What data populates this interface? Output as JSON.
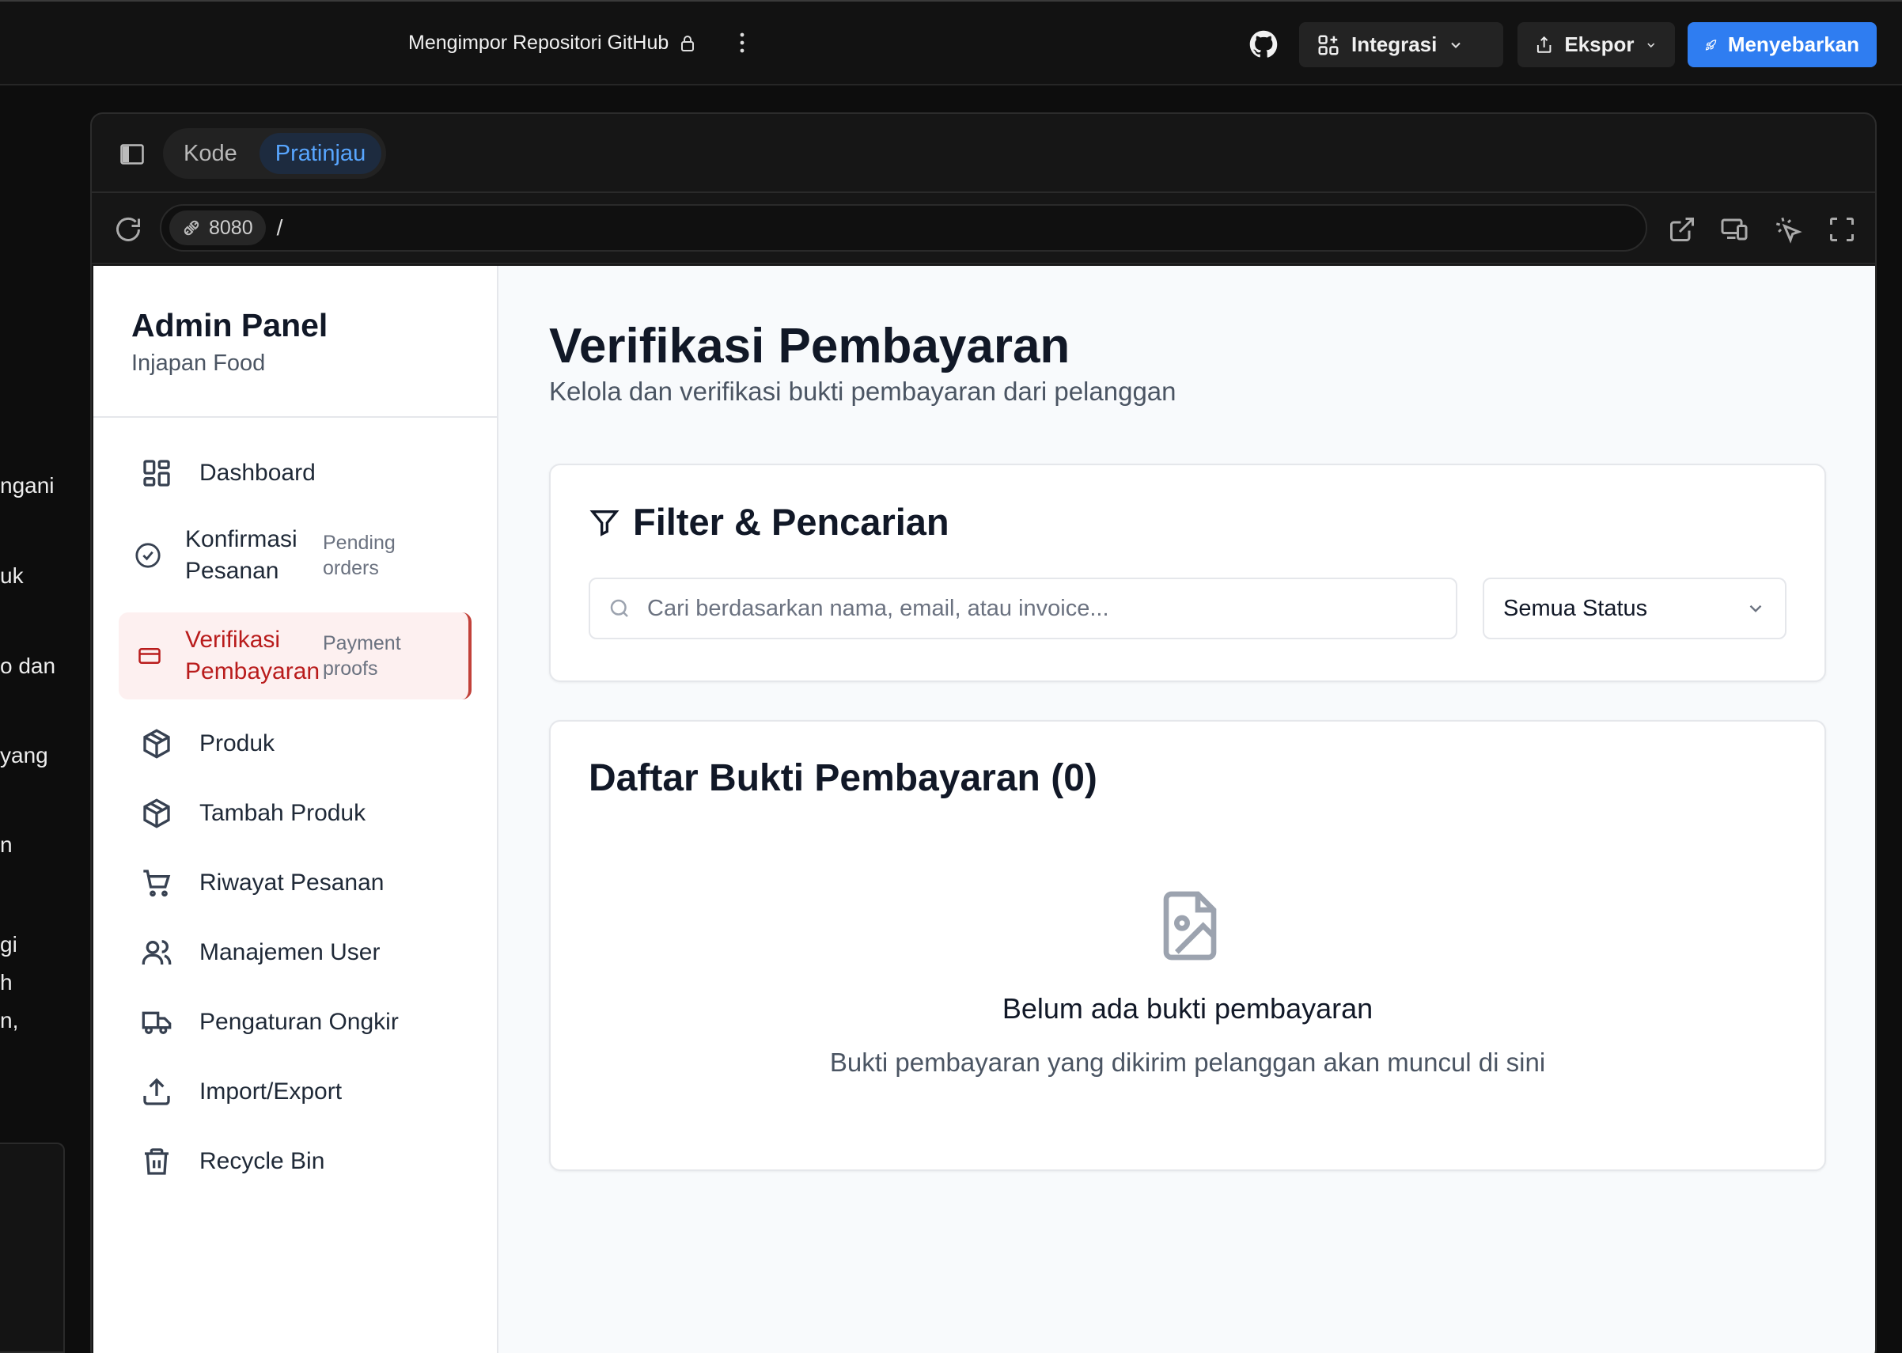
{
  "topbar": {
    "project_title": "Mengimpor Repositori GitHub",
    "integrations_label": "Integrasi",
    "export_label": "Ekspor",
    "deploy_label": "Menyebarkan"
  },
  "background_text": [
    "ngani",
    "uk",
    "o dan",
    "yang",
    "n",
    "gi",
    "h",
    "n,"
  ],
  "preview": {
    "tabs": [
      "Kode",
      "Pratinjau"
    ],
    "active_tab": "Pratinjau",
    "port": "8080",
    "path": "/"
  },
  "sidebar": {
    "title": "Admin Panel",
    "subtitle": "Injapan Food",
    "items": [
      {
        "label": "Dashboard",
        "icon": "dashboard-icon"
      },
      {
        "label": "Konfirmasi Pesanan",
        "sub": "Pending orders",
        "icon": "check-circle-icon"
      },
      {
        "label": "Verifikasi Pembayaran",
        "sub": "Payment proofs",
        "icon": "credit-card-icon",
        "active": true
      },
      {
        "label": "Produk",
        "icon": "package-icon"
      },
      {
        "label": "Tambah Produk",
        "icon": "package-icon"
      },
      {
        "label": "Riwayat Pesanan",
        "icon": "cart-icon"
      },
      {
        "label": "Manajemen User",
        "icon": "users-icon"
      },
      {
        "label": "Pengaturan Ongkir",
        "icon": "truck-icon"
      },
      {
        "label": "Import/Export",
        "icon": "upload-icon"
      },
      {
        "label": "Recycle Bin",
        "icon": "trash-icon"
      }
    ]
  },
  "main": {
    "title": "Verifikasi Pembayaran",
    "subtitle": "Kelola dan verifikasi bukti pembayaran dari pelanggan",
    "filter": {
      "heading": "Filter & Pencarian",
      "search_placeholder": "Cari berdasarkan nama, email, atau invoice...",
      "status_value": "Semua Status"
    },
    "list": {
      "heading": "Daftar Bukti Pembayaran (0)",
      "empty_title": "Belum ada bukti pembayaran",
      "empty_sub": "Bukti pembayaran yang dikirim pelanggan akan muncul di sini"
    }
  },
  "colors": {
    "accent": "#2f7df1",
    "active_nav": "#b91c1c",
    "active_nav_bg": "#fdf0f0"
  }
}
